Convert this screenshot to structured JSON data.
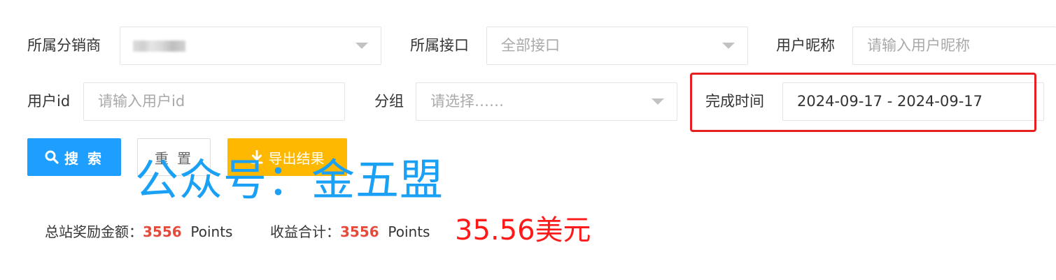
{
  "filters": {
    "distributor": {
      "label": "所属分销商",
      "value": ""
    },
    "interface": {
      "label": "所属接口",
      "value": "全部接口"
    },
    "nickname": {
      "label": "用户昵称",
      "placeholder": "请输入用户昵称"
    },
    "user_id": {
      "label": "用户id",
      "placeholder": "请输入用户id"
    },
    "group": {
      "label": "分组",
      "placeholder": "请选择……"
    },
    "complete_time": {
      "label": "完成时间",
      "value": "2024-09-17 - 2024-09-17"
    }
  },
  "buttons": {
    "search": "搜 索",
    "reset": "重 置",
    "export": "导出结果"
  },
  "watermark": "公众号：金五盟",
  "summary": {
    "reward_label": "总站奖励金额：",
    "reward_value": "3556",
    "reward_unit": "Points",
    "income_label": "收益合计：",
    "income_value": "3556",
    "income_unit": "Points",
    "usd_note": "35.56美元"
  },
  "colors": {
    "primary": "#1e9fff",
    "warning": "#ffb800",
    "highlight": "#e62020",
    "number": "#e54b3c",
    "watermark": "#1aa0f5"
  }
}
